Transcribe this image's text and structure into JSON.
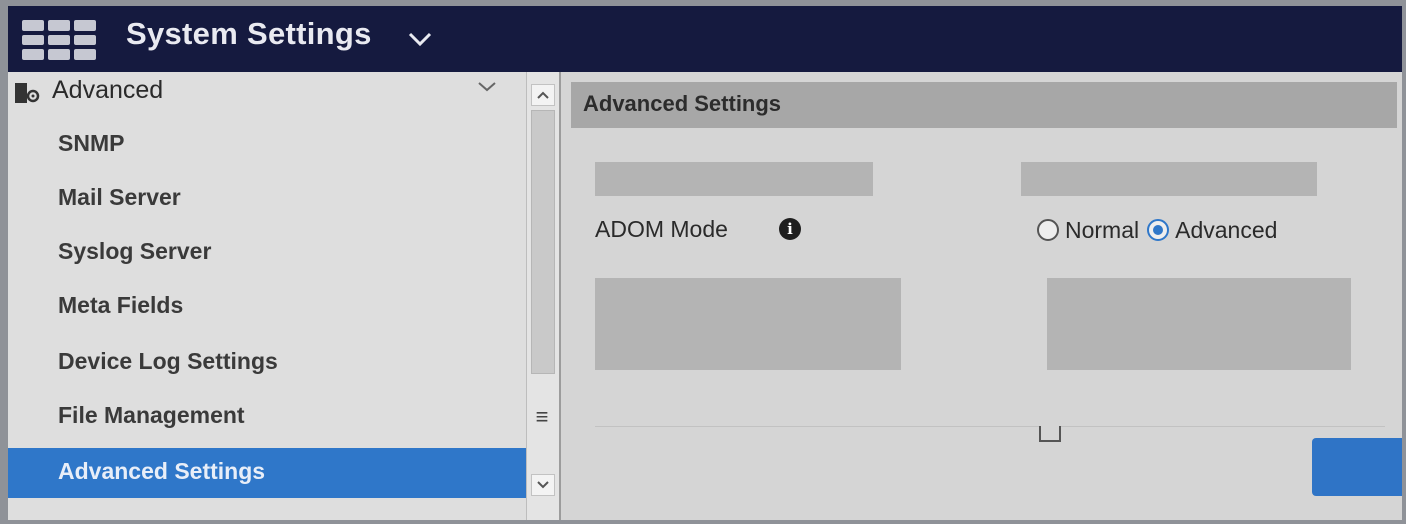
{
  "header": {
    "title": "System Settings",
    "chevron_icon": "chevron-down-icon",
    "apps_icon": "apps-grid-icon"
  },
  "sidebar": {
    "group": {
      "label": "Advanced",
      "icon": "advanced-settings-icon"
    },
    "items": [
      {
        "label": "SNMP",
        "active": false
      },
      {
        "label": "Mail Server",
        "active": false
      },
      {
        "label": "Syslog Server",
        "active": false
      },
      {
        "label": "Meta Fields",
        "active": false
      },
      {
        "label": "Device Log Settings",
        "active": false
      },
      {
        "label": "File Management",
        "active": false
      },
      {
        "label": "Advanced Settings",
        "active": true
      }
    ]
  },
  "main": {
    "section_title": "Advanced Settings",
    "adom_mode": {
      "label": "ADOM Mode",
      "options": [
        {
          "label": "Normal",
          "checked": false
        },
        {
          "label": "Advanced",
          "checked": true
        }
      ]
    }
  },
  "colors": {
    "header_bg": "#151a3f",
    "accent": "#2f77c9"
  }
}
